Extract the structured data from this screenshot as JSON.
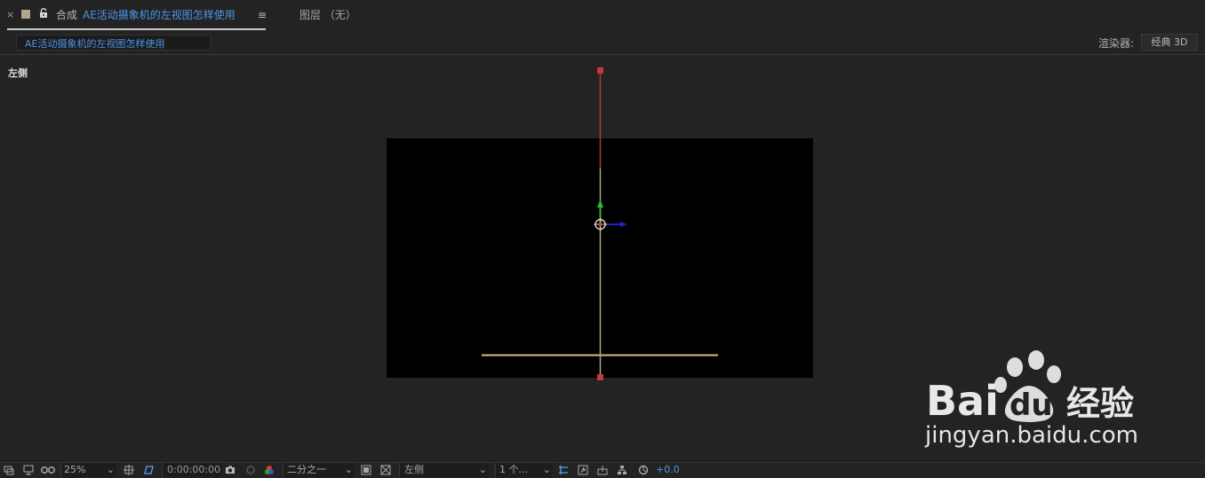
{
  "tabs": {
    "active_prefix": "合成",
    "active_name": "AE活动摄象机的左视图怎样使用",
    "close_glyph": "×",
    "menu_glyph": "≡",
    "layer_tab": "图层 （无）",
    "swatch_color": "#b6a58c"
  },
  "breadcrumb": {
    "label": "AE活动摄象机的左视图怎样使用"
  },
  "renderer": {
    "label": "渲染器:",
    "value": "经典 3D"
  },
  "viewer": {
    "view_label": "左侧",
    "canvas_color": "#000000",
    "axis_colors": {
      "x": "#cc3333",
      "y": "#2fb82f",
      "z": "#2222cc",
      "ground": "#cfc27a"
    }
  },
  "watermark": {
    "brand": "Bai",
    "brand2": "du",
    "cn": "经验",
    "url": "jingyan.baidu.com"
  },
  "toolbar": {
    "zoom": "25%",
    "timecode": "0:00:00:00",
    "resolution": "二分之一",
    "view": "左侧",
    "views_count": "1 个...",
    "exposure": "+0.0",
    "icons": [
      "always-preview-icon",
      "monitor-icon",
      "mask-visibility-icon",
      "zoom-dropdown-icon",
      "region-of-interest-icon",
      "transparency-grid-icon",
      "snapshot-icon",
      "show-snapshot-icon",
      "channel-icon",
      "toggle-transparency-icon",
      "view-layout-icon",
      "reset-exposure-icon",
      "3d-draft-icon",
      "flowchart-icon"
    ]
  }
}
